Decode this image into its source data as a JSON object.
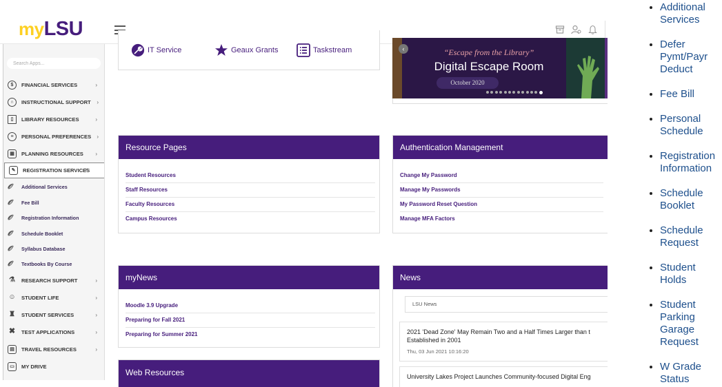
{
  "header": {
    "logo_my": "my",
    "logo_lsu": "LSU",
    "icons": [
      "archive-icon",
      "user-icon",
      "bell-icon"
    ]
  },
  "sidebar": {
    "search_placeholder": "Search Apps...",
    "items": [
      {
        "label": "FINANCIAL SERVICES",
        "icon": "dollar-icon",
        "chevron": "›"
      },
      {
        "label": "INSTRUCTIONAL SUPPORT",
        "icon": "headset-icon",
        "chevron": "›"
      },
      {
        "label": "LIBRARY RESOURCES",
        "icon": "book-icon",
        "chevron": "›"
      },
      {
        "label": "PERSONAL PREFERENCES",
        "icon": "sliders-icon",
        "chevron": "›"
      },
      {
        "label": "PLANNING RESOURCES",
        "icon": "calendar-icon",
        "chevron": "›"
      },
      {
        "label": "REGISTRATION SERVICES",
        "icon": "edit-icon",
        "chevron": "˅"
      }
    ],
    "subitems": [
      "Additional Services",
      "Fee Bill",
      "Registration Information",
      "Schedule Booklet",
      "Syllabus Database",
      "Textbooks By Course"
    ],
    "items2": [
      {
        "label": "RESEARCH SUPPORT",
        "icon": "flask-icon",
        "chevron": "›"
      },
      {
        "label": "STUDENT LIFE",
        "icon": "people-icon",
        "chevron": "›"
      },
      {
        "label": "STUDENT SERVICES",
        "icon": "student-icon",
        "chevron": "›"
      },
      {
        "label": "TEST APPLICATIONS",
        "icon": "tools-icon",
        "chevron": "›"
      },
      {
        "label": "TRAVEL RESOURCES",
        "icon": "suitcase-icon",
        "chevron": "›"
      },
      {
        "label": "MY DRIVE",
        "icon": "drive-icon",
        "chevron": ""
      }
    ]
  },
  "quick_links": [
    {
      "label": "IT Service"
    },
    {
      "label": "Geaux Grants"
    },
    {
      "label": "Taskstream"
    }
  ],
  "banner": {
    "subtitle": "“Escape from the Library”",
    "title": "Digital Escape Room",
    "date": "October 2020"
  },
  "resource_pages": {
    "title": "Resource Pages",
    "links": [
      "Student Resources",
      "Staff Resources",
      "Faculty Resources",
      "Campus Resources"
    ]
  },
  "auth": {
    "title": "Authentication Management",
    "links": [
      "Change My Password",
      "Manage My Passwords",
      "My Password Reset Question",
      "Manage MFA Factors"
    ]
  },
  "mynews": {
    "title": "myNews",
    "links": [
      "Moodle 3.9 Upgrade",
      "Preparing for Fall 2021",
      "Preparing for Summer 2021"
    ]
  },
  "news": {
    "title": "News",
    "source": "LSU News",
    "items": [
      {
        "title": "2021 'Dead Zone' May Remain Two and a Half Times Larger than t",
        "title2": "Established in 2001",
        "date": "Thu, 03 Jun 2021 10:16:20"
      },
      {
        "title": "University Lakes Project Launches Community-focused Digital Eng"
      }
    ]
  },
  "web_resources": {
    "title": "Web Resources"
  },
  "right_list": [
    "Additional Services",
    "Defer Pymt/Payr Deduct",
    "Fee Bill",
    "Personal Schedule",
    "Registration Information",
    "Schedule Booklet",
    "Schedule Request",
    "Student Holds",
    "Student Parking Garage Request",
    "W Grade Status"
  ]
}
